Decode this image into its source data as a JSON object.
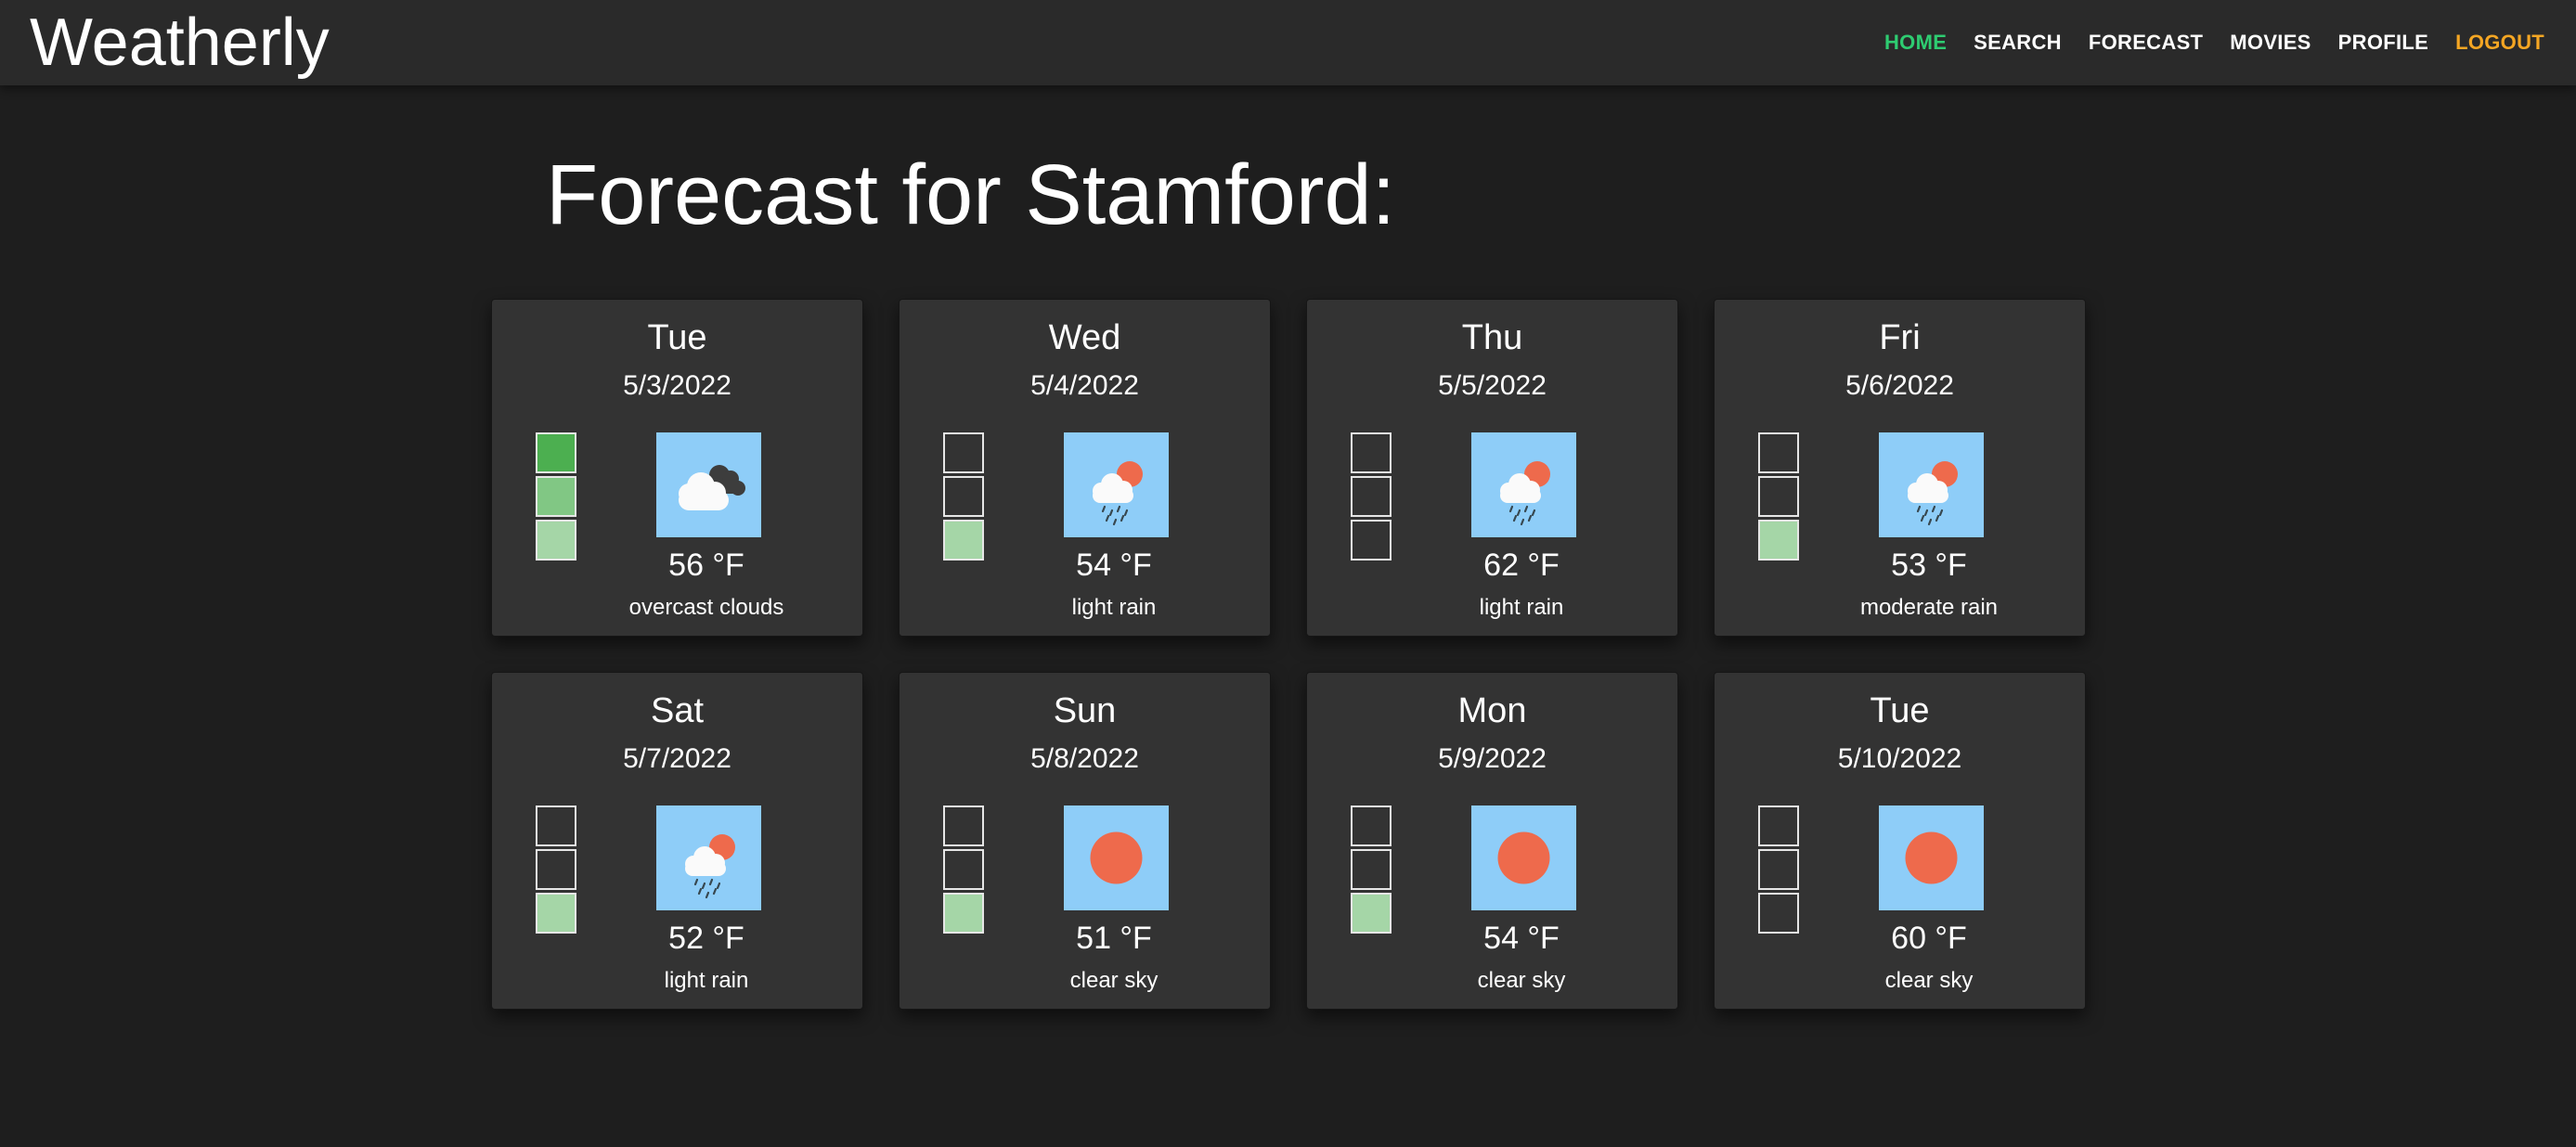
{
  "app": {
    "brand": "Weatherly"
  },
  "nav": {
    "items": [
      {
        "label": "HOME",
        "state": "active",
        "color": "#2ecc71"
      },
      {
        "label": "SEARCH",
        "state": "normal",
        "color": "#ffffff"
      },
      {
        "label": "FORECAST",
        "state": "normal",
        "color": "#ffffff"
      },
      {
        "label": "MOVIES",
        "state": "normal",
        "color": "#ffffff"
      },
      {
        "label": "PROFILE",
        "state": "normal",
        "color": "#ffffff"
      },
      {
        "label": "LOGOUT",
        "state": "logout",
        "color": "#f5a623"
      }
    ]
  },
  "page": {
    "title": "Forecast for Stamford:"
  },
  "colors": {
    "meter_levels": [
      "#a5d6a7",
      "#81c784",
      "#4caf50"
    ],
    "icon_background": "#8ecdf8",
    "sun": "#ee6a4c"
  },
  "forecast": [
    {
      "day": "Tue",
      "date": "5/3/2022",
      "temp": "56 °F",
      "desc": "overcast clouds",
      "icon": "overcast-clouds-icon",
      "level": 3
    },
    {
      "day": "Wed",
      "date": "5/4/2022",
      "temp": "54 °F",
      "desc": "light rain",
      "icon": "rain-sun-icon",
      "level": 1
    },
    {
      "day": "Thu",
      "date": "5/5/2022",
      "temp": "62 °F",
      "desc": "light rain",
      "icon": "rain-sun-icon",
      "level": 0
    },
    {
      "day": "Fri",
      "date": "5/6/2022",
      "temp": "53 °F",
      "desc": "moderate rain",
      "icon": "rain-sun-icon",
      "level": 1
    },
    {
      "day": "Sat",
      "date": "5/7/2022",
      "temp": "52 °F",
      "desc": "light rain",
      "icon": "rain-sun-icon",
      "level": 1
    },
    {
      "day": "Sun",
      "date": "5/8/2022",
      "temp": "51 °F",
      "desc": "clear sky",
      "icon": "sun-icon",
      "level": 1
    },
    {
      "day": "Mon",
      "date": "5/9/2022",
      "temp": "54 °F",
      "desc": "clear sky",
      "icon": "sun-icon",
      "level": 1
    },
    {
      "day": "Tue",
      "date": "5/10/2022",
      "temp": "60 °F",
      "desc": "clear sky",
      "icon": "sun-icon",
      "level": 0
    }
  ]
}
